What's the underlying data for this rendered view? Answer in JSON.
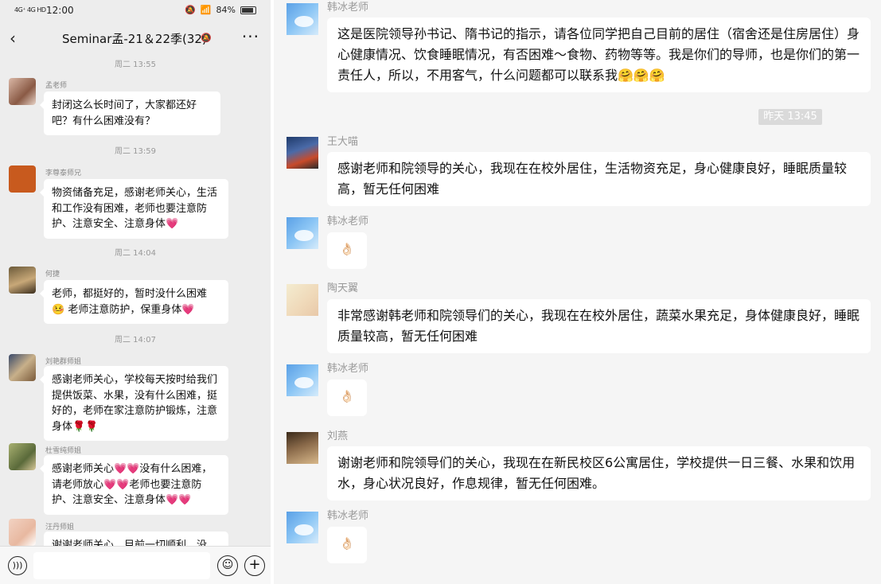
{
  "status_bar": {
    "signal": "4G⁺ 4G HD",
    "time": "12:00",
    "battery": "84%"
  },
  "chat": {
    "title": "Seminar孟-21＆22季(32)",
    "back_icon": "chevron-left-icon",
    "more_icon": "more-dots-icon"
  },
  "left_messages": {
    "ts1": "周二 13:55",
    "ts2": "周二 13:59",
    "ts3": "周二 14:04",
    "ts4": "周二 14:07",
    "m1": {
      "sender": "孟老师",
      "text": "封闭这么长时间了，大家都还好吧？有什么困难没有？"
    },
    "m2": {
      "sender": "李尊泰师兄",
      "text": "物资储备充足，感谢老师关心，生活和工作没有困难，老师也要注意防护、注意安全、注意身体💗"
    },
    "m3": {
      "sender": "何捷",
      "text": "老师，都挺好的，暂时没什么困难 🤒 老师注意防护，保重身体💗"
    },
    "m4": {
      "sender": "刘艳群师姐",
      "text": "感谢老师关心，学校每天按时给我们提供饭菜、水果，没有什么困难，挺好的，老师在家注意防护锻炼，注意身体🌹🌹"
    },
    "m5": {
      "sender": "杜雪纯师姐",
      "text": "感谢老师关心💗💗没有什么困难，请老师放心💗💗老师也要注意防护、注意安全、注意身体💗💗"
    },
    "m6": {
      "sender": "汪丹师姐",
      "text": "谢谢老师关心，目前一切顺利，没"
    }
  },
  "right_messages": {
    "timestamp": "昨天 13:45",
    "r1": {
      "sender": "韩冰老师",
      "text": "这是医院领导孙书记、隋书记的指示，请各位同学把自己目前的居住（宿舍还是住房居住）身心健康情况、饮食睡眠情况，有否困难～食物、药物等等。我是你们的导师，也是你们的第一责任人，所以，不用客气，什么问题都可以联系我🤗🤗🤗"
    },
    "r2": {
      "sender": "王大喵",
      "text": "感谢老师和院领导的关心，我现在在校外居住，生活物资充足，身心健康良好，睡眠质量较高，暂无任何困难"
    },
    "r3": {
      "sender": "韩冰老师",
      "text": "👌🏻"
    },
    "r4": {
      "sender": "陶天翼",
      "text": "非常感谢韩老师和院领导们的关心，我现在在校外居住，蔬菜水果充足，身体健康良好，睡眠质量较高，暂无任何困难"
    },
    "r5": {
      "sender": "韩冰老师",
      "text": "👌🏻"
    },
    "r6": {
      "sender": "刘燕",
      "text": "谢谢老师和院领导们的关心，我现在在新民校区6公寓居住，学校提供一日三餐、水果和饮用水，身心状况良好，作息规律，暂无任何困难。"
    },
    "r7": {
      "sender": "韩冰老师",
      "text": "👌🏻"
    }
  },
  "icons": {
    "voice": "voice-icon",
    "emoji": "emoji-icon",
    "plus": "plus-icon"
  }
}
